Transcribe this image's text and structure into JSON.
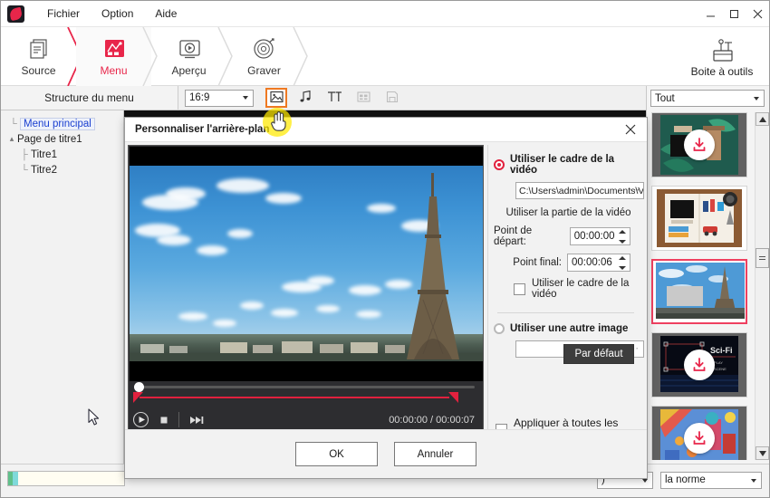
{
  "window": {
    "app_icon": "app-logo-icon",
    "menus": [
      "Fichier",
      "Option",
      "Aide"
    ],
    "controls": {
      "minimize": "—",
      "maximize": "☐",
      "close": "✕"
    }
  },
  "ribbon": {
    "steps": [
      {
        "label": "Source",
        "icon": "documents-icon",
        "active": false
      },
      {
        "label": "Menu",
        "icon": "menu-template-icon",
        "active": true
      },
      {
        "label": "Aperçu",
        "icon": "preview-play-icon",
        "active": false
      },
      {
        "label": "Graver",
        "icon": "burn-disc-icon",
        "active": false
      }
    ],
    "toolbox": {
      "label": "Boite à outils",
      "icon": "toolbox-icon"
    },
    "accent_color": "#e8264a"
  },
  "subbar": {
    "structure_label": "Structure du menu",
    "aspect_ratio": "16:9",
    "icons": [
      {
        "name": "background-image-icon",
        "selected": true,
        "disabled": false
      },
      {
        "name": "music-note-icon",
        "selected": false,
        "disabled": false
      },
      {
        "name": "text-title-icon",
        "selected": false,
        "disabled": false
      },
      {
        "name": "grid-layout-icon",
        "selected": false,
        "disabled": true
      },
      {
        "name": "save-template-icon",
        "selected": false,
        "disabled": true
      }
    ],
    "highlight_color": "#ef7922"
  },
  "tree": {
    "nodes": [
      {
        "label": "Menu principal",
        "level": 0,
        "selected": true
      },
      {
        "label": "Page de titre1",
        "level": 0,
        "selected": false,
        "expander": "▴"
      },
      {
        "label": "Titre1",
        "level": 1,
        "selected": false
      },
      {
        "label": "Titre2",
        "level": 1,
        "selected": false
      }
    ]
  },
  "templates": {
    "category": "Tout",
    "items": [
      {
        "name": "template-tropical",
        "locked": true,
        "active": false
      },
      {
        "name": "template-scrapbook",
        "locked": false,
        "active": false
      },
      {
        "name": "template-eiffel",
        "locked": false,
        "active": true
      },
      {
        "name": "template-scifi",
        "locked": true,
        "active": false,
        "caption": "Sci-Fi"
      },
      {
        "name": "template-cartoon",
        "locked": true,
        "active": false
      }
    ]
  },
  "dialog": {
    "title": "Personnaliser l'arrière-plan",
    "close_icon": "close-icon",
    "player": {
      "current_time": "00:00:00",
      "total_time": "00:00:07",
      "timecode": "00:00:00 / 00:00:07",
      "controls": [
        {
          "name": "play-button",
          "glyph": "▶"
        },
        {
          "name": "stop-button",
          "glyph": "■"
        },
        {
          "name": "next-frame-button",
          "glyph": "⏭"
        }
      ]
    },
    "options": {
      "use_video_frame_label": "Utiliser le cadre de la vidéo",
      "video_path": "C:\\Users\\admin\\Documents\\V",
      "browse_dots": "⋯",
      "use_video_part_label": "Utiliser la partie de la vidéo",
      "start_point_label": "Point de départ:",
      "start_point_value": "00:00:00",
      "end_point_label": "Point final:",
      "end_point_value": "00:00:06",
      "use_video_frame_check_label": "Utiliser le cadre de la vidéo",
      "use_other_image_label": "Utiliser une autre image",
      "other_image_value": "",
      "default_button": "Par défaut",
      "apply_all_pages_label": "Appliquer à toutes les pages"
    },
    "footer": {
      "ok": "OK",
      "cancel": "Annuler"
    }
  },
  "statusbar": {
    "disk_indicator": "disk-space-bar",
    "select_partial": ")",
    "select_standard": "la norme"
  }
}
